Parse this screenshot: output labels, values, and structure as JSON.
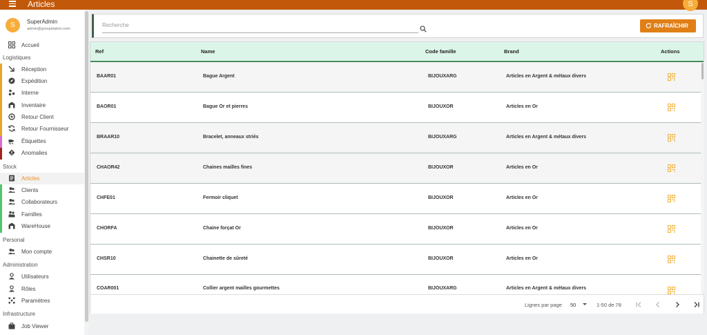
{
  "app": {
    "title": "Articles",
    "user_initial": "S"
  },
  "profile": {
    "initial": "S",
    "name": "SuperAdmin",
    "email": "admin@groupstation.com"
  },
  "sidebar": {
    "home": {
      "label": "Accueil",
      "icon": "dashboard-icon"
    },
    "sections": {
      "logistiques": "Logistiques",
      "stock": "Stock",
      "personal": "Personal",
      "administration": "Administration",
      "infrastructure": "Infrastructure"
    },
    "logistiques_items": [
      {
        "label": "Réception",
        "icon": "arrow-down-right-icon",
        "bar_color": "#e6a52a"
      },
      {
        "label": "Expédition",
        "icon": "compass-icon",
        "bar_color": "#e6a52a"
      },
      {
        "label": "Interne",
        "icon": "scatter-icon",
        "bar_color": "#e6a52a"
      },
      {
        "label": "Inventaire",
        "icon": "warehouse-icon",
        "bar_color": "#e6a52a"
      },
      {
        "label": "Retour Client",
        "icon": "return-icon",
        "bar_color": "#e6a52a"
      },
      {
        "label": "Retour Fournisseur",
        "icon": "sync-icon",
        "bar_color": "#e6a52a"
      },
      {
        "label": "Étiquettes",
        "icon": "label-icon",
        "bar_color": "#d96ad2"
      },
      {
        "label": "Anomalies",
        "icon": "warning-diamond-icon",
        "bar_color": "#a3231f"
      }
    ],
    "stock_items": [
      {
        "label": "Articles",
        "icon": "article-icon",
        "active": true
      },
      {
        "label": "Clients",
        "icon": "people-icon"
      },
      {
        "label": "Collaborateurs",
        "icon": "people-icon"
      },
      {
        "label": "Familles",
        "icon": "family-icon"
      },
      {
        "label": "WareHouse",
        "icon": "warehouse-icon"
      }
    ],
    "personal_items": [
      {
        "label": "Mon compte",
        "icon": "people-icon"
      }
    ],
    "administration_items": [
      {
        "label": "Utilisateurs",
        "icon": "person-icon"
      },
      {
        "label": "Rôles",
        "icon": "person-icon"
      },
      {
        "label": "Paramètres",
        "icon": "settings-grid-icon"
      }
    ],
    "infrastructure_items": [
      {
        "label": "Job Viewer",
        "icon": "briefcase-icon"
      }
    ]
  },
  "search": {
    "placeholder": "Recherche",
    "value": ""
  },
  "toolbar": {
    "refresh_label": "RAFRAÎCHIR"
  },
  "table": {
    "headers": {
      "ref": "Ref",
      "name": "Name",
      "code_famille": "Code famille",
      "brand": "Brand",
      "actions": "Actions"
    },
    "rows": [
      {
        "ref": "BAAR01",
        "name": "Bague Argent",
        "code": "BIJOUXARG",
        "brand": "Articles en Argent & métaux divers"
      },
      {
        "ref": "BAOR01",
        "name": "Bague Or et pierres",
        "code": "BIJOUXOR",
        "brand": "Articles en Or"
      },
      {
        "ref": "BRAAR10",
        "name": "Bracelet, anneaux striés",
        "code": "BIJOUXARG",
        "brand": "Articles en Argent & métaux divers"
      },
      {
        "ref": "CHAOR42",
        "name": "Chaines mailles fines",
        "code": "BIJOUXOR",
        "brand": "Articles en Or"
      },
      {
        "ref": "CHFE01",
        "name": "Fermoir cliquet",
        "code": "BIJOUXOR",
        "brand": "Articles en Or"
      },
      {
        "ref": "CHORFA",
        "name": "Chaine forçat Or",
        "code": "BIJOUXOR",
        "brand": "Articles en Or"
      },
      {
        "ref": "CHSR10",
        "name": "Chainette de sûreté",
        "code": "BIJOUXOR",
        "brand": "Articles en Or"
      },
      {
        "ref": "COAR001",
        "name": "Collier argent mailles gourmettes",
        "code": "BIJOUXARG",
        "brand": "Articles en Argent & métaux divers"
      }
    ],
    "action_icon": "qr-code-icon"
  },
  "pagination": {
    "rows_label": "Lignes par page",
    "page_size": "50",
    "range": "1-50 de 78"
  },
  "colors": {
    "topbar": "#c2590a",
    "accent": "#e07f16",
    "header_bg": "#dcf5e9",
    "header_border": "#4c8a5c",
    "active_text": "#ef8d1e",
    "qr": "#f0b03a"
  }
}
